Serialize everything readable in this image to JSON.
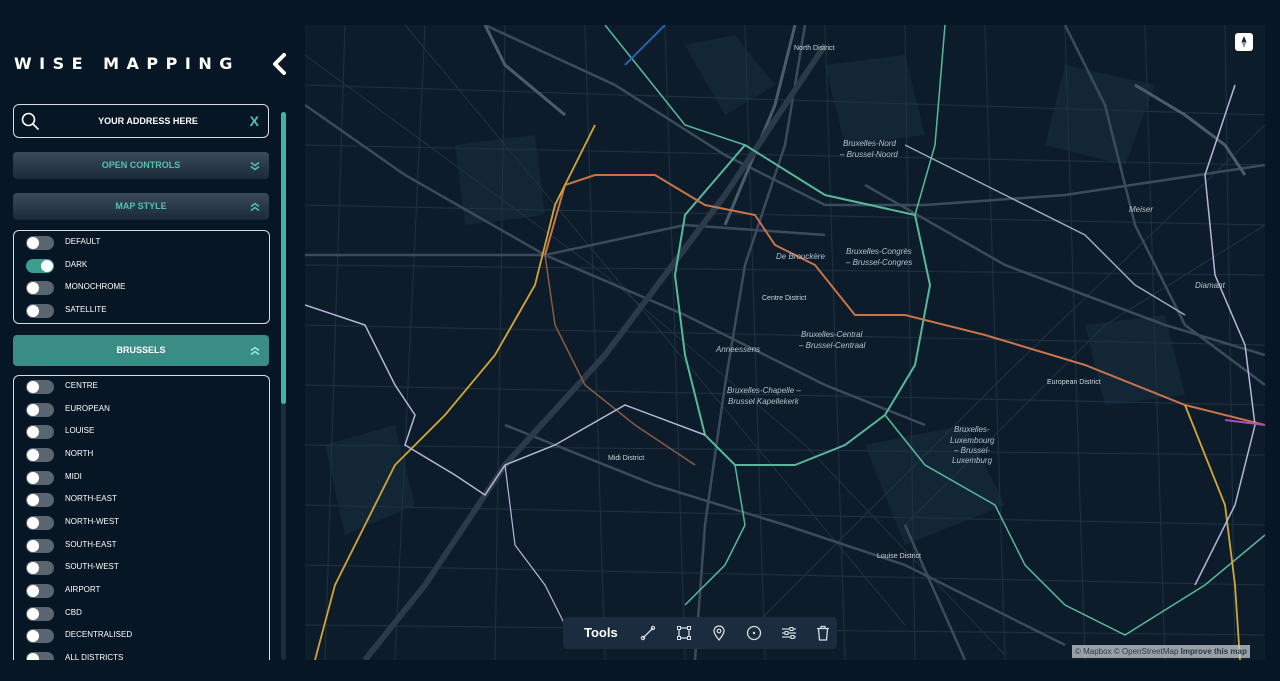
{
  "brand": {
    "title": "WISE   MAPPING"
  },
  "search": {
    "placeholder": "YOUR ADDRESS HERE",
    "clear_label": "X"
  },
  "panels": {
    "open_controls": "OPEN CONTROLS",
    "map_style": "MAP STYLE",
    "region": "BRUSSELS"
  },
  "map_styles": [
    {
      "label": "DEFAULT",
      "on": false
    },
    {
      "label": "DARK",
      "on": true
    },
    {
      "label": "MONOCHROME",
      "on": false
    },
    {
      "label": "SATELLITE",
      "on": false
    }
  ],
  "districts": [
    {
      "label": "CENTRE",
      "on": false
    },
    {
      "label": "EUROPEAN",
      "on": false
    },
    {
      "label": "LOUISE",
      "on": false
    },
    {
      "label": "NORTH",
      "on": false
    },
    {
      "label": "MIDI",
      "on": false
    },
    {
      "label": "NORTH-EAST",
      "on": false
    },
    {
      "label": "NORTH-WEST",
      "on": false
    },
    {
      "label": "SOUTH-EAST",
      "on": false
    },
    {
      "label": "SOUTH-WEST",
      "on": false
    },
    {
      "label": "AIRPORT",
      "on": false
    },
    {
      "label": "CBD",
      "on": false
    },
    {
      "label": "DECENTRALISED",
      "on": false
    },
    {
      "label": "ALL DISTRICTS",
      "on": false
    }
  ],
  "map": {
    "labels": {
      "north_district": "North District",
      "bruxelles_nord": "Bruxelles-Nord",
      "brussel_noord": "– Brussel-Noord",
      "meiser": "Meiser",
      "de_brouckere": "De Brouckère",
      "bruxelles_congres": "Bruxelles-Congrès",
      "brussel_congres": "– Brussel-Congres",
      "diamant": "Diamant",
      "centre_district": "Centre District",
      "bruxelles_central": "Bruxelles-Central",
      "brussel_centraal": "– Brussel-Centraal",
      "anneessens": "Anneessens",
      "european_district": "European District",
      "bruxelles_chapelle": "Bruxelles-Chapelle –",
      "brussel_kapellekerk": "Brussel Kapellekerk",
      "bruxelles_luxembourg_1": "Bruxelles-",
      "bruxelles_luxembourg_2": "Luxembourg",
      "bruxelles_luxembourg_3": "– Brussel-",
      "bruxelles_luxembourg_4": "Luxemburg",
      "midi_district": "Midi District",
      "louise_district": "Louise District"
    },
    "tools_label": "Tools",
    "tool_icons": [
      "line-icon",
      "polygon-icon",
      "marker-icon",
      "circle-icon",
      "filters-icon",
      "trash-icon"
    ],
    "attribution": {
      "mapbox": "© Mapbox",
      "osm": "© OpenStreetMap",
      "improve": "Improve this map"
    }
  },
  "colors": {
    "accent": "#3fb6a2",
    "background": "#061624",
    "map_background": "#0d1c2a",
    "metro_orange": "#c8744a",
    "metro_yellow": "#d1a634",
    "metro_green": "#58b89c",
    "metro_lavender": "#b6b6d6"
  }
}
